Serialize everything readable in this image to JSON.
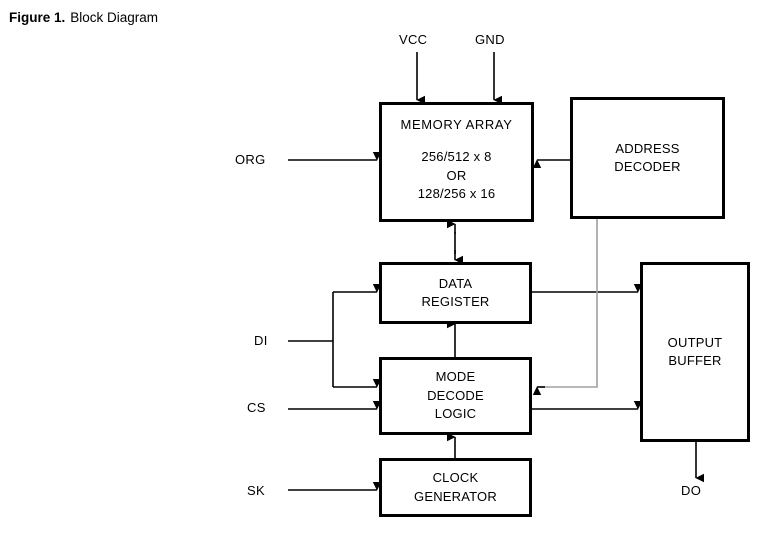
{
  "caption": {
    "figure_number": "Figure 1.",
    "title": "Block Diagram"
  },
  "colors": {
    "background": "#ffffff",
    "stroke": "#000000",
    "secondary_stroke": "#a0a0a0"
  },
  "blocks": {
    "memory_array": {
      "title": "MEMORY  ARRAY",
      "line1": "256/512  x  8",
      "line2": "OR",
      "line3": "128/256  x  16"
    },
    "address_decoder": {
      "line1": "ADDRESS",
      "line2": "DECODER"
    },
    "data_register": {
      "line1": "DATA",
      "line2": "REGISTER"
    },
    "mode_decode_logic": {
      "line1": "MODE",
      "line2": "DECODE",
      "line3": "LOGIC"
    },
    "clock_generator": {
      "line1": "CLOCK",
      "line2": "GENERATOR"
    },
    "output_buffer": {
      "line1": "OUTPUT",
      "line2": "BUFFER"
    }
  },
  "pins": {
    "vcc": "VCC",
    "gnd": "GND",
    "org": "ORG",
    "di": "DI",
    "cs": "CS",
    "sk": "SK",
    "do": "DO"
  }
}
